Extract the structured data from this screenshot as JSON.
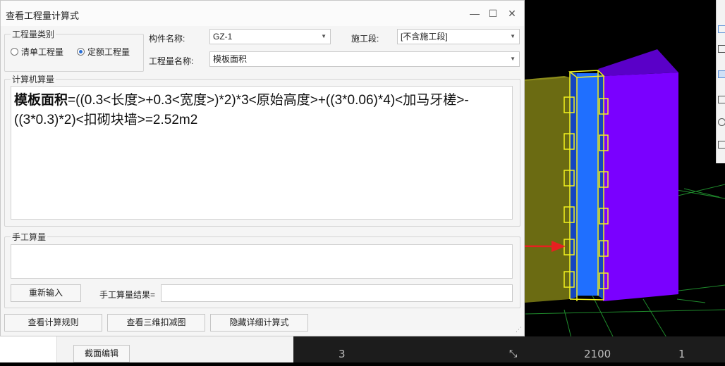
{
  "window": {
    "title": "查看工程量计算式",
    "minimize_icon": "minimize-icon",
    "maximize_icon": "maximize-icon",
    "close_icon": "close-icon"
  },
  "quantity_type": {
    "legend": "工程量类别",
    "options": [
      {
        "label": "清单工程量",
        "selected": false
      },
      {
        "label": "定额工程量",
        "selected": true
      }
    ]
  },
  "fields": {
    "component_name_label": "构件名称:",
    "component_name_value": "GZ-1",
    "construction_section_label": "施工段:",
    "construction_section_value": "[不含施工段]",
    "quantity_name_label": "工程量名称:",
    "quantity_name_value": "模板面积"
  },
  "computed": {
    "legend": "计算机算量",
    "formula_name": "模板面积",
    "formula_body": "=((0.3<长度>+0.3<宽度>)*2)*3<原始高度>+((3*0.06)*4)<加马牙槎>-((3*0.3)*2)<扣砌块墙>=2.52m2"
  },
  "manual": {
    "legend": "手工算量",
    "reenter_button": "重新输入",
    "result_label": "手工算量结果="
  },
  "bottom_buttons": {
    "view_rules": "查看计算规则",
    "view_3d": "查看三维扣减图",
    "hide_detail": "隐藏详细计算式"
  },
  "behind": {
    "section_edit_button": "截面编辑"
  },
  "viewport": {
    "axis_labels": [
      "3",
      "2100",
      "1"
    ]
  },
  "colors": {
    "wall_olive": "#6b6b12",
    "column_blue": "#1f6fff",
    "wall_purple": "#7a00ff",
    "highlight_yellow": "#f2f21e",
    "arrow_red": "#e82020",
    "grid_green": "#1f8a2c"
  }
}
